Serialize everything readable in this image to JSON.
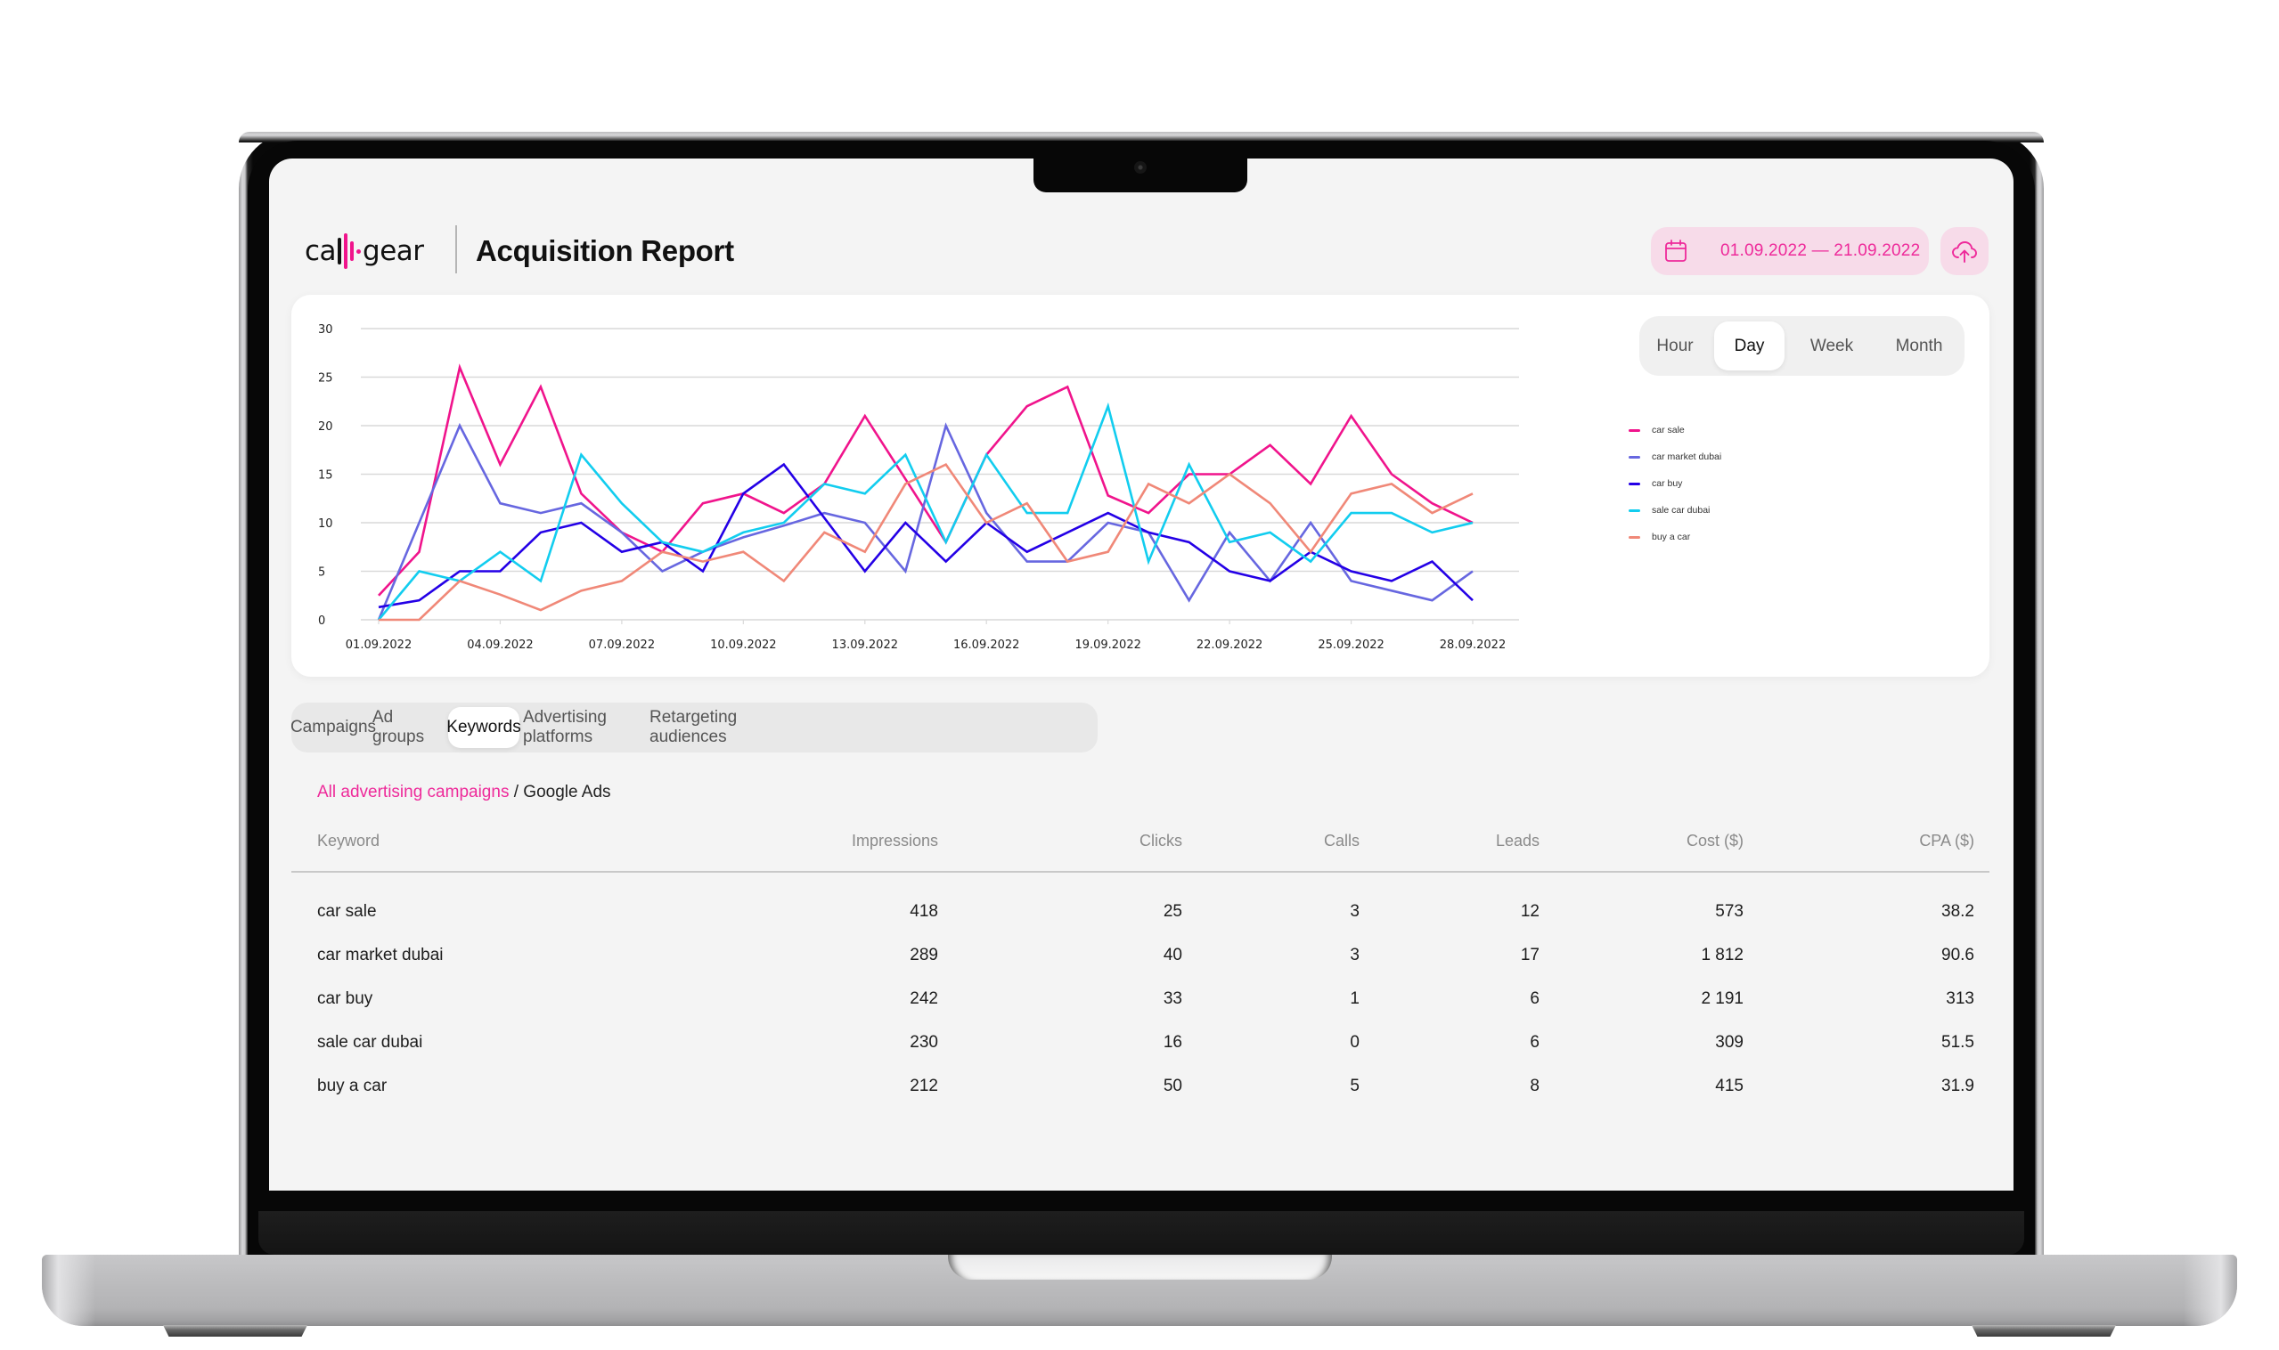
{
  "header": {
    "logo_text_left": "ca",
    "logo_text_right": "gear",
    "title": "Acquisition Report",
    "date_range": "01.09.2022 — 21.09.2022",
    "icons": {
      "date": "calendar-icon",
      "upload": "cloud-upload-icon"
    }
  },
  "colors": {
    "accent": "#ee2a9a",
    "accent_bg": "#f7dbe9",
    "series": [
      "#f0148c",
      "#6767e0",
      "#2400e6",
      "#12cdef",
      "#f08878"
    ]
  },
  "granularity": {
    "options": [
      "Hour",
      "Day",
      "Week",
      "Month"
    ],
    "selected": "Day"
  },
  "tabs": {
    "items": [
      "Campaigns",
      "Ad groups",
      "Keywords",
      "Advertising platforms",
      "Retargeting audiences"
    ],
    "selected": "Keywords"
  },
  "breadcrumb": {
    "link": "All advertising campaigns",
    "separator": " / ",
    "current": "Google Ads"
  },
  "table": {
    "columns": [
      "Keyword",
      "Impressions",
      "Clicks",
      "Calls",
      "Leads",
      "Cost ($)",
      "CPA ($)"
    ],
    "rows": [
      [
        "car sale",
        "418",
        "25",
        "3",
        "12",
        "573",
        "38.2"
      ],
      [
        "car market dubai",
        "289",
        "40",
        "3",
        "17",
        "1 812",
        "90.6"
      ],
      [
        "car buy",
        "242",
        "33",
        "1",
        "6",
        "2 191",
        "313"
      ],
      [
        "sale car dubai",
        "230",
        "16",
        "0",
        "6",
        "309",
        "51.5"
      ],
      [
        "buy a car",
        "212",
        "50",
        "5",
        "8",
        "415",
        "31.9"
      ]
    ]
  },
  "chart_data": {
    "type": "line",
    "title": "",
    "xlabel": "",
    "ylabel": "",
    "ylim": [
      0,
      30
    ],
    "yticks": [
      0,
      5,
      10,
      15,
      20,
      25,
      30
    ],
    "grid": true,
    "legend_position": "right",
    "x": [
      "01.09.2022",
      "02.09.2022",
      "03.09.2022",
      "04.09.2022",
      "05.09.2022",
      "06.09.2022",
      "07.09.2022",
      "08.09.2022",
      "09.09.2022",
      "10.09.2022",
      "11.09.2022",
      "12.09.2022",
      "13.09.2022",
      "14.09.2022",
      "15.09.2022",
      "16.09.2022",
      "17.09.2022",
      "18.09.2022",
      "19.09.2022",
      "20.09.2022",
      "21.09.2022",
      "22.09.2022",
      "23.09.2022",
      "24.09.2022",
      "25.09.2022",
      "26.09.2022",
      "27.09.2022",
      "28.09.2022"
    ],
    "xtick_labels": [
      "01.09.2022",
      "04.09.2022",
      "07.09.2022",
      "10.09.2022",
      "13.09.2022",
      "16.09.2022",
      "19.09.2022",
      "22.09.2022",
      "25.09.2022",
      "28.09.2022"
    ],
    "series": [
      {
        "name": "car sale",
        "color": "#f0148c",
        "values": [
          2.5,
          7,
          26,
          16,
          24,
          13,
          9,
          7,
          12,
          13,
          11,
          14,
          21,
          14.5,
          8,
          17,
          22,
          24,
          12.8,
          11,
          15,
          15,
          18,
          14,
          21,
          15,
          12,
          10
        ]
      },
      {
        "name": "car market dubai",
        "color": "#6767e0",
        "values": [
          0,
          10,
          20,
          12,
          11,
          12,
          9,
          5,
          7,
          8.5,
          9.7,
          11,
          10,
          5,
          20,
          11,
          6,
          6,
          10,
          9,
          2,
          9,
          4,
          10,
          4,
          3,
          2,
          5
        ]
      },
      {
        "name": "car buy",
        "color": "#2400e6",
        "values": [
          1.3,
          2,
          5,
          5,
          9,
          10,
          7,
          8,
          5,
          13,
          16,
          10.5,
          5,
          10,
          6,
          10,
          7,
          9,
          11,
          9,
          8,
          5,
          4,
          7,
          5,
          4,
          6,
          2
        ]
      },
      {
        "name": "sale car dubai",
        "color": "#12cdef",
        "values": [
          0,
          5,
          4,
          7,
          4,
          17,
          12,
          8,
          7,
          9,
          10,
          14,
          13,
          17,
          8,
          17,
          11,
          11,
          22,
          6,
          16,
          8,
          9,
          6,
          11,
          11,
          9,
          10
        ]
      },
      {
        "name": "buy a car",
        "color": "#f08878",
        "values": [
          0,
          0,
          4,
          2.6,
          1,
          3,
          4,
          7,
          6,
          7,
          4,
          9,
          7,
          14,
          16,
          10,
          12,
          6,
          7,
          14,
          12,
          15,
          12,
          7,
          13,
          14,
          11,
          13
        ]
      }
    ]
  }
}
